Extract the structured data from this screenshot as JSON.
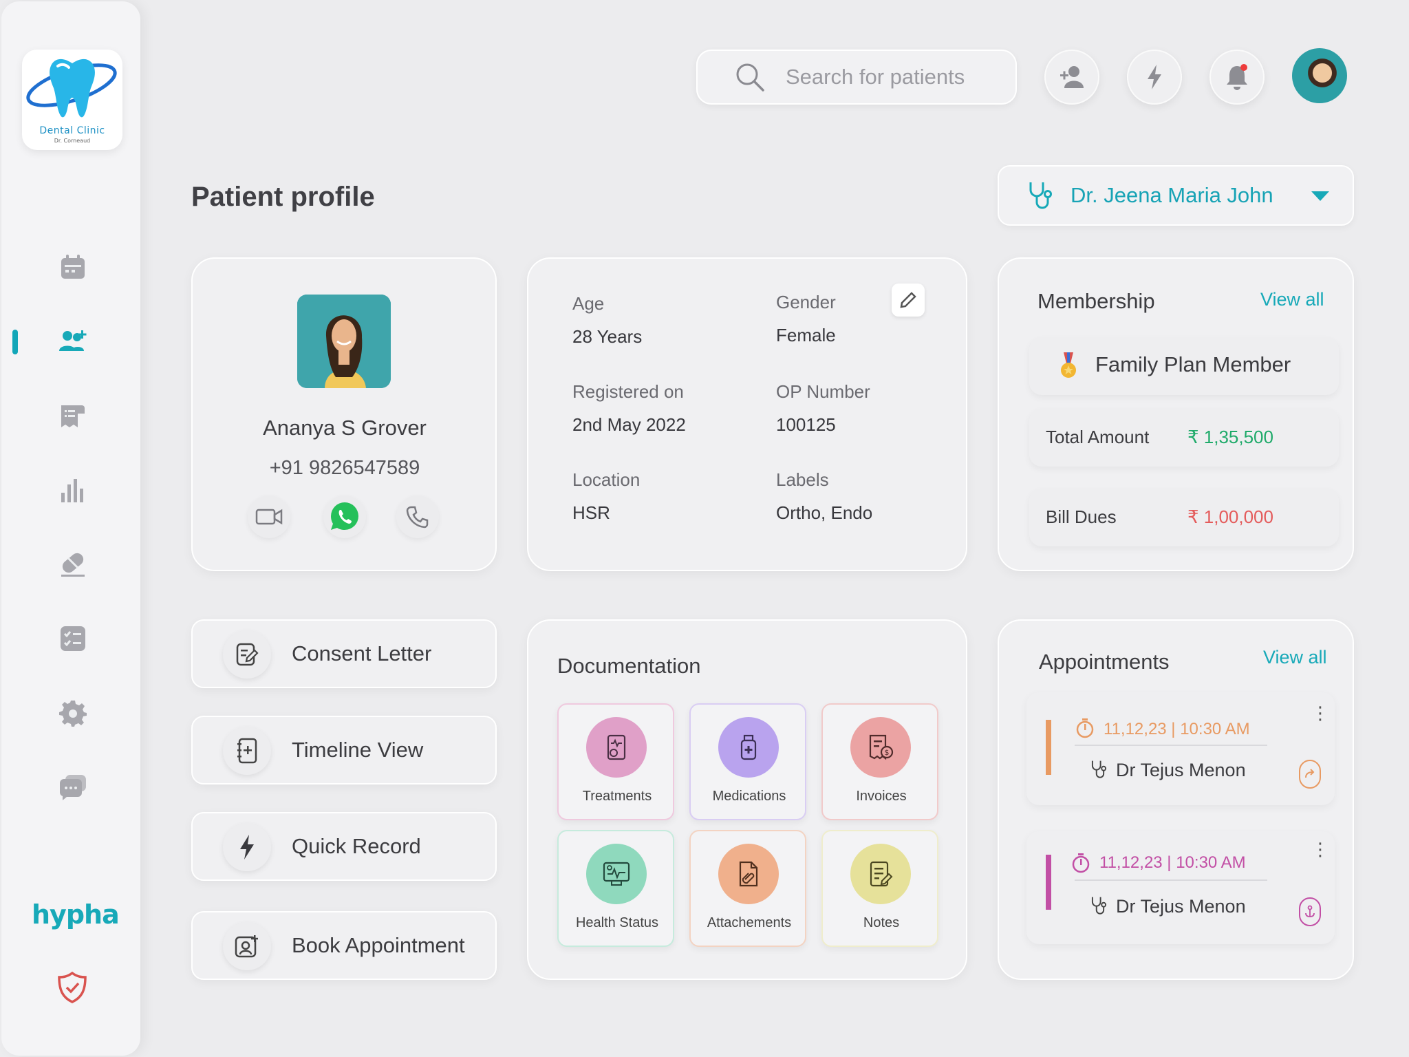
{
  "app": {
    "logo_title": "Dental Clinic",
    "logo_subtitle": "Dr. Corneaud",
    "brand": "hypha"
  },
  "search": {
    "placeholder": "Search for patients"
  },
  "page_title": "Patient profile",
  "doctor_select": {
    "value": "Dr. Jeena Maria John"
  },
  "patient": {
    "name": "Ananya S Grover",
    "phone": "+91 9826547589"
  },
  "info": {
    "age_label": "Age",
    "age_value": "28 Years",
    "gender_label": "Gender",
    "gender_value": "Female",
    "registered_label": "Registered on",
    "registered_value": "2nd May 2022",
    "op_label": "OP Number",
    "op_value": "100125",
    "location_label": "Location",
    "location_value": "HSR",
    "labels_label": "Labels",
    "labels_value": "Ortho, Endo"
  },
  "membership": {
    "title": "Membership",
    "view_all": "View all",
    "plan": "Family Plan Member",
    "total_label": "Total Amount",
    "total_value": "₹ 1,35,500",
    "dues_label": "Bill Dues",
    "dues_value": "₹ 1,00,000"
  },
  "actions": [
    {
      "label": "Consent Letter"
    },
    {
      "label": "Timeline View"
    },
    {
      "label": "Quick Record"
    },
    {
      "label": "Book Appointment"
    }
  ],
  "documentation": {
    "title": "Documentation",
    "tiles": [
      {
        "label": "Treatments",
        "color": "#e0a0c8"
      },
      {
        "label": "Medications",
        "color": "#b9a3ee"
      },
      {
        "label": "Invoices",
        "color": "#eba3a3"
      },
      {
        "label": "Health Status",
        "color": "#8fd9bd"
      },
      {
        "label": "Attachements",
        "color": "#f0b08c"
      },
      {
        "label": "Notes",
        "color": "#e6e19a"
      }
    ]
  },
  "appointments": {
    "title": "Appointments",
    "view_all": "View all",
    "items": [
      {
        "time": "11,12,23 | 10:30 AM",
        "doctor": "Dr Tejus Menon",
        "color": "#e89a62"
      },
      {
        "time": "11,12,23 | 10:30 AM",
        "doctor": "Dr Tejus Menon",
        "color": "#c24fa5"
      }
    ]
  },
  "colors": {
    "accent": "#17a9b8",
    "total_green": "#1faa6a",
    "dues_red": "#e45b5b"
  }
}
